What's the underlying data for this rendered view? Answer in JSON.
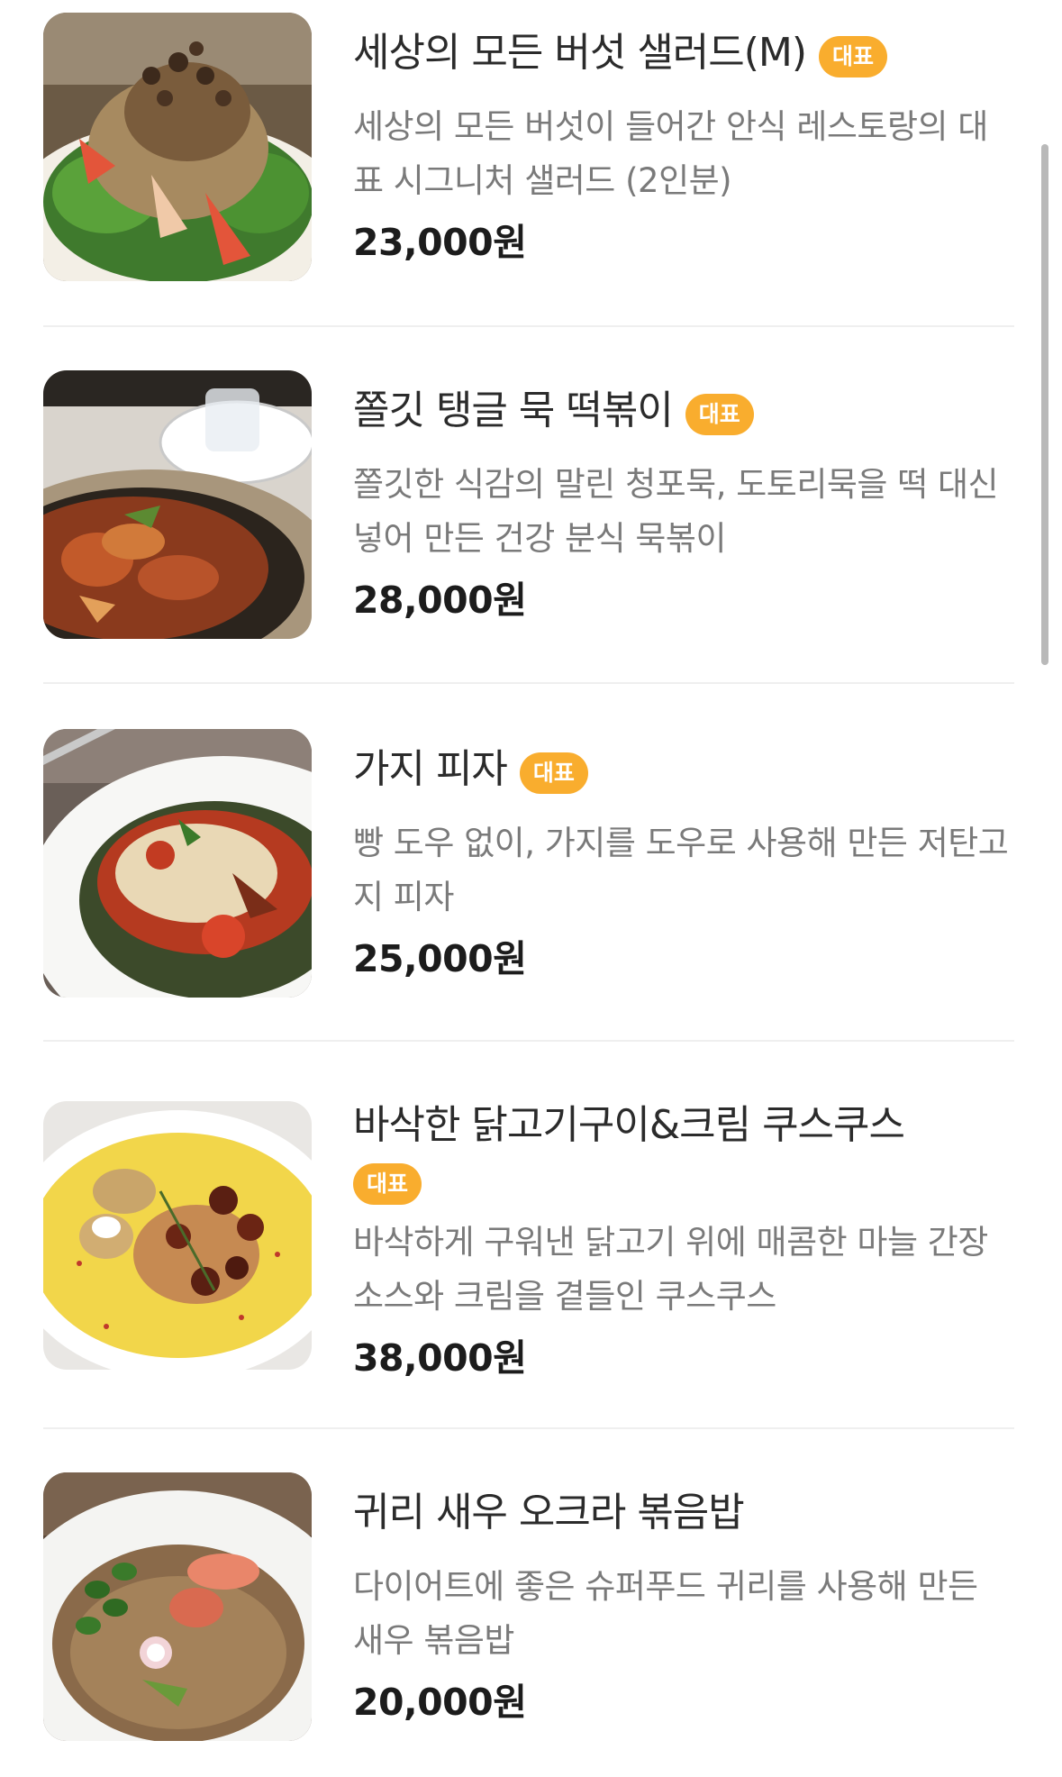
{
  "menu": {
    "badge_label": "대표",
    "items": [
      {
        "title": "세상의 모든 버섯 샐러드(M)",
        "badge": "대표",
        "description": "세상의 모든 버섯이 들어간 안식 레스토랑의 대표 시그니처 샐러드 (2인분)",
        "price": "23,000원",
        "image_icon": "mushroom-salad-photo"
      },
      {
        "title": "쫄깃 탱글 묵 떡볶이",
        "badge": "대표",
        "description": "쫄깃한 식감의 말린 청포묵, 도토리묵을 떡 대신 넣어 만든 건강 분식 묵볶이",
        "price": "28,000원",
        "image_icon": "muk-tteokbokki-photo"
      },
      {
        "title": "가지 피자",
        "badge": "대표",
        "description": "빵 도우 없이, 가지를 도우로 사용해 만든 저탄고지 피자",
        "price": "25,000원",
        "image_icon": "eggplant-pizza-photo"
      },
      {
        "title": "바삭한 닭고기구이&크림 쿠스쿠스",
        "badge": "대표",
        "description": "바삭하게 구워낸 닭고기 위에 매콤한 마늘 간장소스와 크림을 곁들인 쿠스쿠스",
        "price": "38,000원",
        "image_icon": "chicken-couscous-photo"
      },
      {
        "title": "귀리 새우 오크라 볶음밥",
        "badge": "",
        "description": "다이어트에 좋은 슈퍼푸드 귀리를 사용해 만든 새우 볶음밥",
        "price": "20,000원",
        "image_icon": "oat-shrimp-rice-photo"
      }
    ]
  },
  "colors": {
    "badge": "#f9ad2e",
    "divider": "#efefef",
    "title": "#2b2b2b",
    "description": "#7a7a7a",
    "price": "#1c1c1c"
  }
}
